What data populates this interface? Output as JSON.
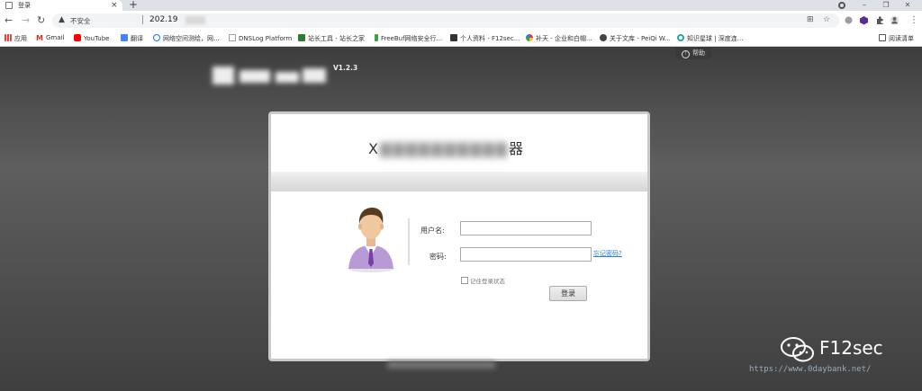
{
  "browser": {
    "tab_title": "登录",
    "tab_close": "×",
    "new_tab": "+",
    "insecure_label": "不安全",
    "url": "202.19",
    "win_min": "–",
    "win_max": "❐",
    "win_close": "✕"
  },
  "bookmarks": [
    {
      "label": "应用",
      "color": "#e8453c"
    },
    {
      "label": "Gmail",
      "color": "#d93025"
    },
    {
      "label": "YouTube",
      "color": "#ff0000"
    },
    {
      "label": "翻译",
      "color": "#4285f4"
    },
    {
      "label": "网络空间测绘，网...",
      "color": "#1a73e8"
    },
    {
      "label": "DNSLog Platform",
      "color": "#9e9e9e"
    },
    {
      "label": "站长工具 - 站长之家",
      "color": "#2e7d32"
    },
    {
      "label": "FreeBuf网络安全行...",
      "color": "#43a047"
    },
    {
      "label": "个人资料 - F12sec...",
      "color": "#333333"
    },
    {
      "label": "补天 - 企业和白帽...",
      "color": "#e53935"
    },
    {
      "label": "关于文库 - PeiQi W...",
      "color": "#444444"
    },
    {
      "label": "知识星球 | 深度连...",
      "color": "#26a69a"
    },
    {
      "label": "阅读清单",
      "color": "#555555"
    }
  ],
  "page": {
    "help_label": "帮助",
    "version": "V1.2.3",
    "title_visible_prefix": "X",
    "title_visible_suffix": "器",
    "username_label": "用户名:",
    "password_label": "密码:",
    "forgot_label": "忘记密码?",
    "remember_label": "记住登录状态",
    "login_label": "登录",
    "username_value": "",
    "password_value": ""
  },
  "watermark": {
    "brand": "F12sec",
    "url": "https://www.0daybank.net/"
  },
  "colors": {
    "link": "#2a7fd4",
    "page_bg": "#4d4d4d"
  }
}
